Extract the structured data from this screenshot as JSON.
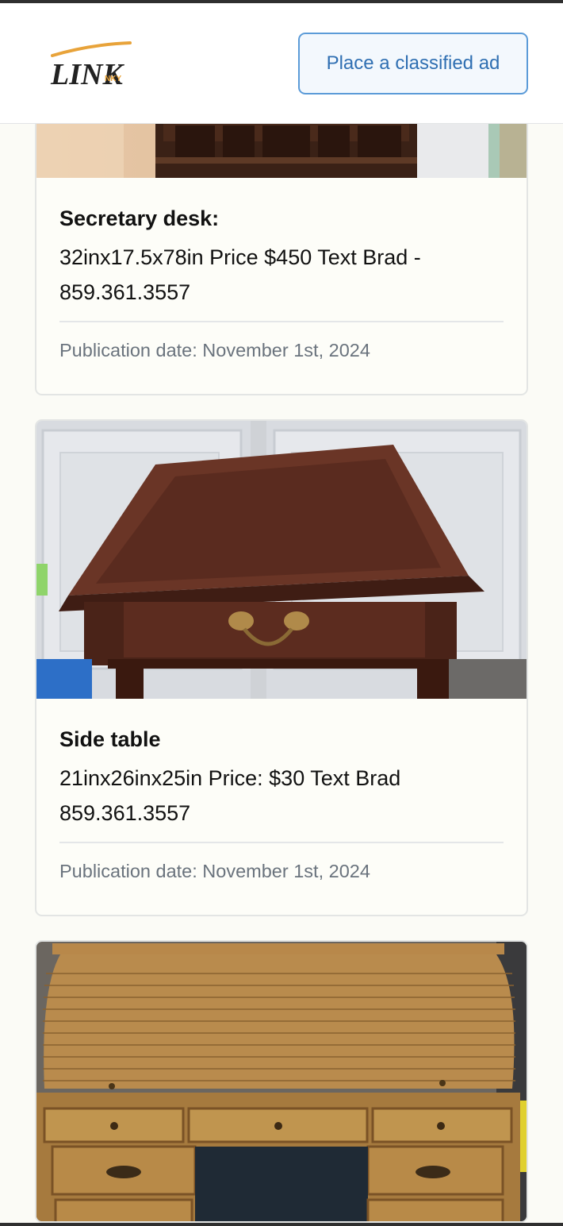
{
  "header": {
    "logo": {
      "text": "LINK",
      "subtext": "NKY"
    },
    "cta_label": "Place a classified ad"
  },
  "listings": [
    {
      "title": "Secretary desk:",
      "description": "32inx17.5x78in Price $450 Text Brad - 859.361.3557",
      "date": "Publication date: November 1st, 2024",
      "image": "secretary-desk-photo"
    },
    {
      "title": "Side table",
      "description": "21inx26inx25in Price: $30 Text Brad 859.361.3557",
      "date": "Publication date: November 1st, 2024",
      "image": "side-table-photo"
    },
    {
      "image": "roll-top-desk-photo"
    }
  ],
  "colors": {
    "accent": "#2f6fb2",
    "accent_border": "#5b9bd8",
    "logo_orange": "#e8a33a",
    "page_bg": "#fbfbf6",
    "muted_text": "#6a737d"
  }
}
